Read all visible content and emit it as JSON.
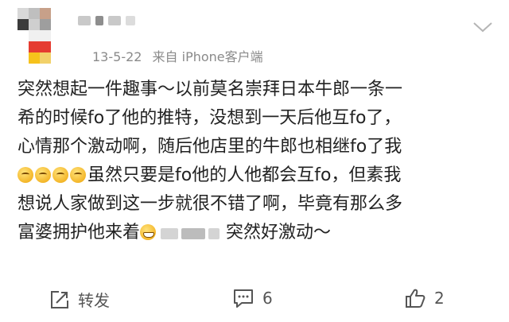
{
  "header": {
    "date": "13-5-22",
    "source": "来自 iPhone客户端"
  },
  "content": {
    "lines": [
      "突然想起一件趣事～以前莫名崇拜日本牛郎一条一",
      "希的时候fo了他的推特，没想到一天后他互fo了，",
      "心情那个激动啊，随后他店里的牛郎也相继fo了我",
      "虽然只要是fo他的人他都会互fo，但素我",
      "想说人家做到这一步就很不错了啊，毕竟有那么多",
      "富婆拥护他来着",
      "突然好激动～"
    ]
  },
  "footer": {
    "repost_label": "转发",
    "comment_count": "6",
    "like_count": "2"
  },
  "icons": {
    "more": "chevron-down-icon",
    "repost": "repost-icon",
    "comment": "comment-icon",
    "like": "thumbs-up-icon"
  }
}
